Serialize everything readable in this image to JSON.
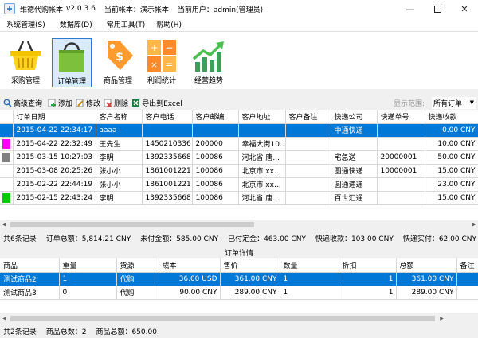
{
  "window": {
    "app_name": "维德代购帐本",
    "version": "v2.0.3.6",
    "current_book": "当前帐本：演示帐本",
    "current_user": "当前用户：admin(管理员)"
  },
  "menu": [
    "系统管理(S)",
    "数据库(D)",
    "常用工具(T)",
    "帮助(H)"
  ],
  "big_toolbar": [
    {
      "label": "采购管理",
      "icon": "basket-icon"
    },
    {
      "label": "订单管理",
      "icon": "shopping-bag-icon",
      "selected": true
    },
    {
      "label": "商品管理",
      "icon": "price-tag-icon"
    },
    {
      "label": "利润统计",
      "icon": "calculator-icon"
    },
    {
      "label": "经营趋势",
      "icon": "trend-chart-icon"
    }
  ],
  "small_toolbar": {
    "search": "高级查询",
    "add": "添加",
    "edit": "修改",
    "delete": "删除",
    "export": "导出到Excel",
    "range_label": "显示范围:",
    "range_value": "所有订单"
  },
  "orders": {
    "columns": [
      "订单日期",
      "客户名称",
      "客户电话",
      "客户邮编",
      "客户地址",
      "客户备注",
      "快递公司",
      "快递单号",
      "快递收款"
    ],
    "rows": [
      {
        "mark": "",
        "cells": [
          "2015-04-22 22:34:17",
          "aaaa",
          "",
          "",
          "",
          "",
          "中通快递",
          "",
          "0.00 CNY"
        ]
      },
      {
        "mark": "#ff00ff",
        "cells": [
          "2015-04-22 22:32:49",
          "王先生",
          "1450210336",
          "200000",
          "幸福大街10...",
          "",
          "",
          "",
          "10.00 CNY"
        ]
      },
      {
        "mark": "#808080",
        "cells": [
          "2015-03-15 10:27:03",
          "李明",
          "1392335668",
          "100086",
          "河北省 唐...",
          "",
          "宅急送",
          "20000001",
          "50.00 CNY"
        ]
      },
      {
        "mark": "",
        "cells": [
          "2015-03-08 20:25:26",
          "张小小",
          "1861001221",
          "100086",
          "北京市 xx...",
          "",
          "圆通快递",
          "10000001",
          "15.00 CNY"
        ]
      },
      {
        "mark": "",
        "cells": [
          "2015-02-22 22:44:19",
          "张小小",
          "1861001221",
          "100086",
          "北京市 xx...",
          "",
          "圆通速递",
          "",
          "23.00 CNY"
        ]
      },
      {
        "mark": "#00cc00",
        "cells": [
          "2015-02-15 22:43:24",
          "李明",
          "1392335668",
          "100086",
          "河北省 唐...",
          "",
          "百世汇通",
          "",
          "15.00 CNY"
        ]
      }
    ]
  },
  "order_summary": {
    "count": "共6条记录",
    "total": "订单总额：5,814.21 CNY",
    "unpaid": "未付金额：585.00 CNY",
    "deposit": "已付定金：463.00 CNY",
    "express_income": "快递收款：103.00 CNY",
    "express_actual": "快递实付：62.00 CNY"
  },
  "detail": {
    "title": "订单详情",
    "columns": [
      "商品",
      "重量",
      "货源",
      "成本",
      "售价",
      "数量",
      "折扣",
      "总额",
      "备注"
    ],
    "rows": [
      {
        "selected": true,
        "cells": [
          "测试商品2",
          "1",
          "代购",
          "36.00 USD",
          "361.00 CNY",
          "1",
          "1",
          "361.00 CNY",
          ""
        ]
      },
      {
        "selected": false,
        "cells": [
          "测试商品3",
          "0",
          "代购",
          "90.00 CNY",
          "289.00 CNY",
          "1",
          "1",
          "289.00 CNY",
          ""
        ]
      }
    ]
  },
  "detail_summary": {
    "count": "共2条记录",
    "goods_count": "商品总数：2",
    "goods_total": "商品总额：650.00"
  },
  "colors": {
    "selection": "#0078d7",
    "selected_button_border": "#2b7bd3"
  }
}
